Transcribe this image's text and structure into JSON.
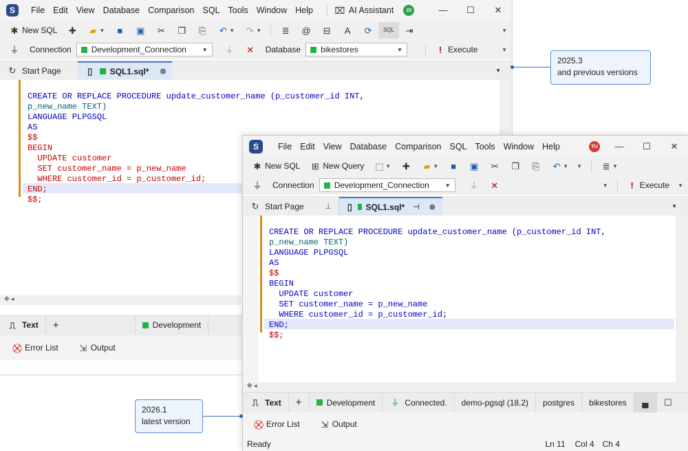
{
  "colors": {
    "accent": "#1f5fae",
    "connection_green": "#22b14c",
    "gutter": "#d4901e",
    "keyword": "#0000c0",
    "identifier": "#005f73",
    "dollar": "#c00000"
  },
  "callouts": {
    "old": {
      "line1": "2025.3",
      "line2": "and previous versions"
    },
    "new": {
      "line1": "2026.1",
      "line2": "latest version"
    }
  },
  "old_window": {
    "menu": [
      "File",
      "Edit",
      "View",
      "Database",
      "Comparison",
      "SQL",
      "Tools",
      "Window",
      "Help"
    ],
    "ai_assistant": "AI Assistant",
    "avatar": "JS",
    "avatar_color": "#2e9e4f",
    "toolbar": {
      "new_sql": "New SQL"
    },
    "connection_label": "Connection",
    "connection_value": "Development_Connection",
    "database_label": "Database",
    "database_value": "bikestores",
    "execute": "Execute",
    "tabs": {
      "start_page": "Start Page",
      "sql1": "SQL1.sql*"
    },
    "bottom": {
      "text_tab": "Text",
      "add": "+",
      "env": "Development",
      "error_list": "Error List",
      "output": "Output"
    }
  },
  "new_window": {
    "menu": [
      "File",
      "Edit",
      "View",
      "Database",
      "Comparison",
      "SQL",
      "Tools",
      "Window",
      "Help"
    ],
    "avatar": "TU",
    "avatar_color": "#d63c3c",
    "toolbar": {
      "new_sql": "New SQL",
      "new_query": "New Query"
    },
    "connection_label": "Connection",
    "connection_value": "Development_Connection",
    "execute": "Execute",
    "tabs": {
      "start_page": "Start Page",
      "sql1": "SQL1.sql*"
    },
    "status_bar": {
      "text_tab": "Text",
      "add": "+",
      "env": "Development",
      "connected": "Connected.",
      "server": "demo-pgsql (18.2)",
      "user": "postgres",
      "database": "bikestores"
    },
    "bottom": {
      "error_list": "Error List",
      "output": "Output",
      "ready": "Ready",
      "ln": "Ln 11",
      "col": "Col 4",
      "ch": "Ch 4"
    }
  },
  "code_lines": [
    "CREATE OR REPLACE PROCEDURE update_customer_name (p_customer_id INT,",
    "p_new_name TEXT)",
    "LANGUAGE PLPGSQL",
    "AS",
    "$$",
    "BEGIN",
    "  UPDATE customer",
    "  SET customer_name = p_new_name",
    "  WHERE customer_id = p_customer_id;",
    "END;",
    "$$;"
  ]
}
